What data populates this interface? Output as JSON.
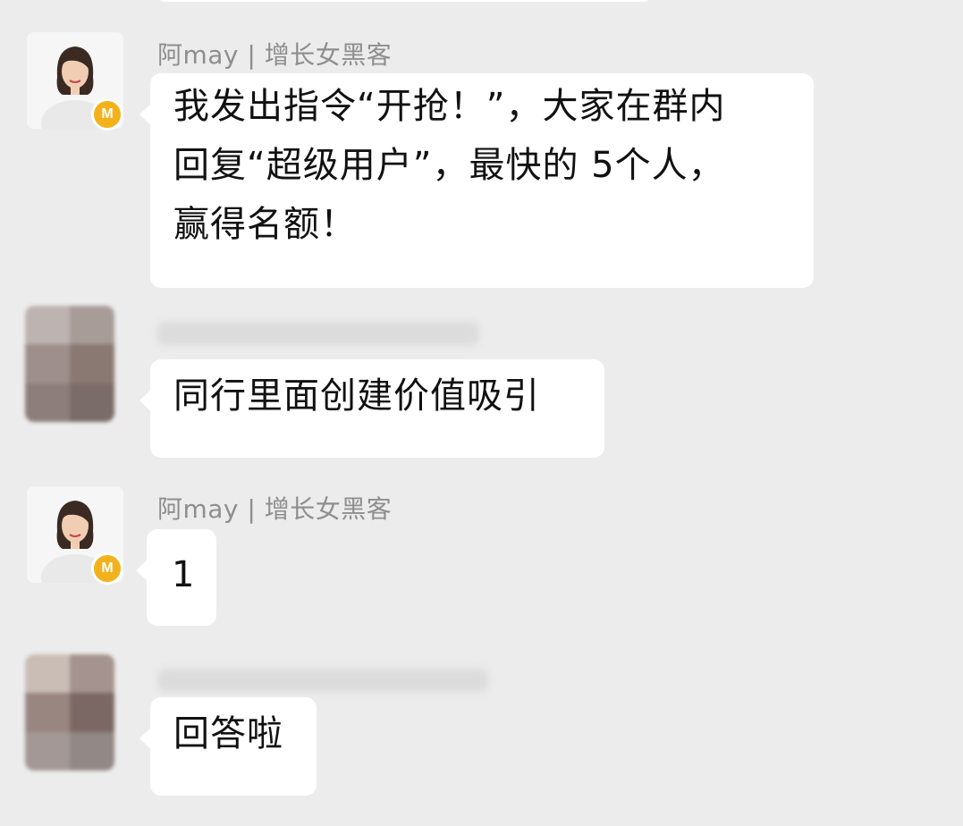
{
  "messages": [
    {
      "sender": "阿may | 增长女黑客",
      "badge": "M",
      "text": "我发出指令“开抢！”，大家在群内\n回复“超级用户”，最快的 5个人，\n赢得名额！"
    },
    {
      "sender": "",
      "text": "同行里面创建价值吸引"
    },
    {
      "sender": "阿may | 增长女黑客",
      "badge": "M",
      "text": "1"
    },
    {
      "sender": "",
      "text": "回答啦"
    }
  ],
  "colors": {
    "background": "#ececec",
    "bubble": "#ffffff",
    "sender_name": "#8e8e8e",
    "badge": "#f3b21b"
  }
}
